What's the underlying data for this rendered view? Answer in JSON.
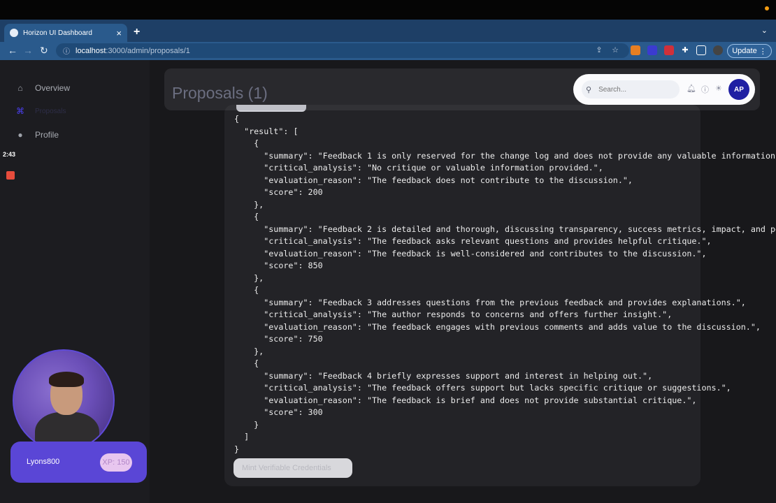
{
  "browser": {
    "tab_title": "Horizon UI Dashboard",
    "close_glyph": "×",
    "new_tab_glyph": "+",
    "url_host": "localhost",
    "url_path": ":3000/admin/proposals/1",
    "update_label": "Update"
  },
  "sidebar": {
    "items": [
      {
        "label": "Overview",
        "icon": "home-icon"
      },
      {
        "label": "Proposals",
        "icon": "proposals-icon"
      },
      {
        "label": "Profile",
        "icon": "user-icon"
      }
    ]
  },
  "recorder": {
    "timer": "2:43"
  },
  "user": {
    "name": "Lyons800",
    "xp": "XP: 150"
  },
  "header": {
    "title": "Proposals (1)",
    "search_placeholder": "Search...",
    "avatar_initials": "AP"
  },
  "result": {
    "lines": [
      "{",
      "  \"result\": [",
      "    {",
      "      \"summary\": \"Feedback 1 is only reserved for the change log and does not provide any valuable information.\",",
      "      \"critical_analysis\": \"No critique or valuable information provided.\",",
      "      \"evaluation_reason\": \"The feedback does not contribute to the discussion.\",",
      "      \"score\": 200",
      "    },",
      "    {",
      "      \"summary\": \"Feedback 2 is detailed and thorough, discussing transparency, success metrics, impact, and potenti",
      "      \"critical_analysis\": \"The feedback asks relevant questions and provides helpful critique.\",",
      "      \"evaluation_reason\": \"The feedback is well-considered and contributes to the discussion.\",",
      "      \"score\": 850",
      "    },",
      "    {",
      "      \"summary\": \"Feedback 3 addresses questions from the previous feedback and provides explanations.\",",
      "      \"critical_analysis\": \"The author responds to concerns and offers further insight.\",",
      "      \"evaluation_reason\": \"The feedback engages with previous comments and adds value to the discussion.\",",
      "      \"score\": 750",
      "    },",
      "    {",
      "      \"summary\": \"Feedback 4 briefly expresses support and interest in helping out.\",",
      "      \"critical_analysis\": \"The feedback offers support but lacks specific critique or suggestions.\",",
      "      \"evaluation_reason\": \"The feedback is brief and does not provide substantial critique.\",",
      "      \"score\": 300",
      "    }",
      "  ]",
      "}"
    ]
  },
  "actions": {
    "mint_label": "Mint Verifiable Credentials"
  }
}
